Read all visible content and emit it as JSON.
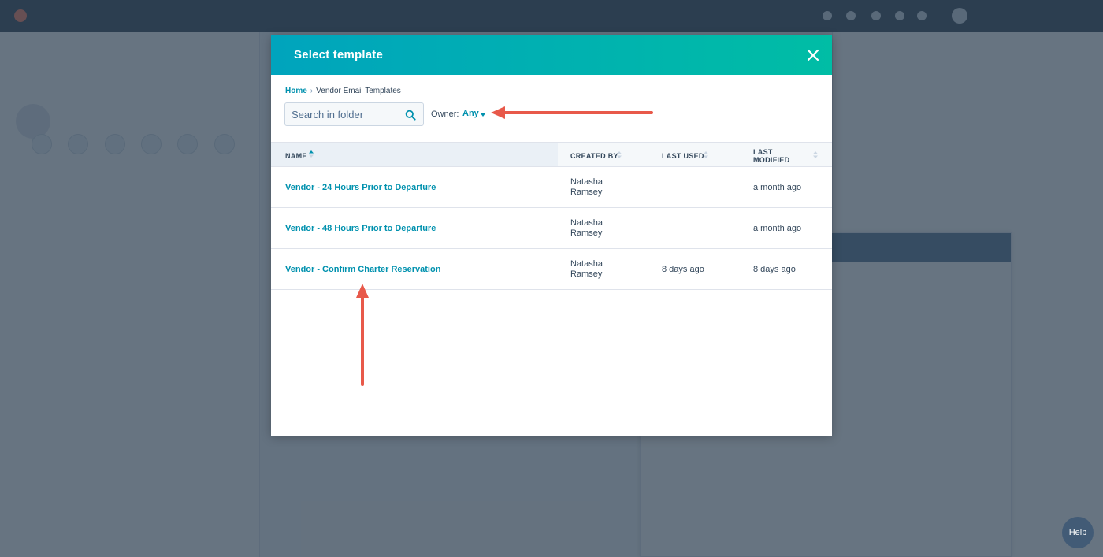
{
  "modal": {
    "title": "Select template",
    "breadcrumb": {
      "home": "Home",
      "separator": "›",
      "current": "Vendor Email Templates"
    },
    "search": {
      "placeholder": "Search in folder",
      "value": ""
    },
    "owner": {
      "label": "Owner:",
      "value": "Any"
    },
    "columns": {
      "name": "NAME",
      "created_by": "CREATED BY",
      "last_used": "LAST USED",
      "last_modified_line1": "LAST",
      "last_modified_line2": "MODIFIED"
    },
    "rows": [
      {
        "name": "Vendor - 24 Hours Prior to Departure",
        "created_by_first": "Natasha",
        "created_by_last": "Ramsey",
        "last_used": "",
        "last_modified": "a month ago"
      },
      {
        "name": "Vendor - 48 Hours Prior to Departure",
        "created_by_first": "Natasha",
        "created_by_last": "Ramsey",
        "last_used": "",
        "last_modified": "a month ago"
      },
      {
        "name": "Vendor - Confirm Charter Reservation",
        "created_by_first": "Natasha",
        "created_by_last": "Ramsey",
        "last_used": "8 days ago",
        "last_modified": "8 days ago"
      }
    ]
  },
  "background": {
    "help_label": "Help"
  },
  "colors": {
    "header_gradient_start": "#00a4bd",
    "header_gradient_end": "#00bda5",
    "link": "#0091ae",
    "annotation_arrow": "#e8594a"
  },
  "icons": {
    "close": "close-icon",
    "search": "search-icon",
    "sort": "sort-icon",
    "caret": "caret-down-icon"
  }
}
